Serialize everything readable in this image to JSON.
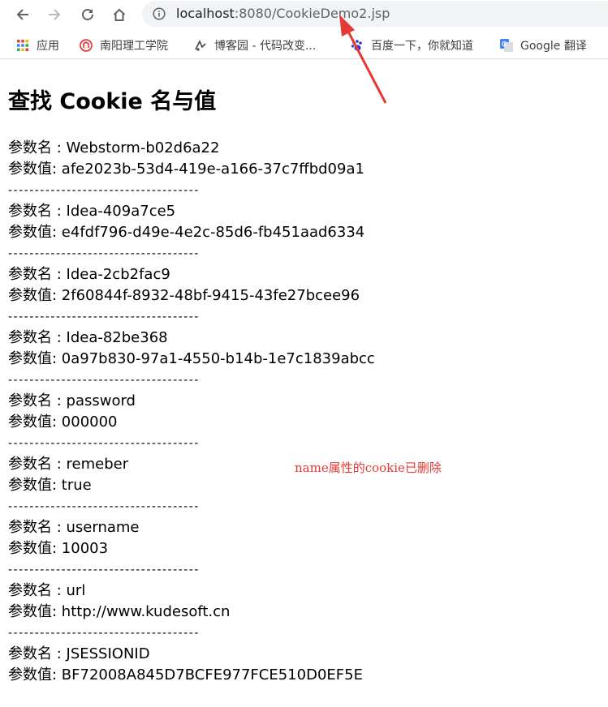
{
  "browser": {
    "url_host": "localhost",
    "url_rest": ":8080/CookieDemo2.jsp",
    "bookmarks": [
      {
        "label": "应用",
        "icon": "apps-grid-icon"
      },
      {
        "label": "南阳理工学院",
        "icon": "school-logo-icon"
      },
      {
        "label": "博客园 - 代码改变...",
        "icon": "cnblogs-icon"
      },
      {
        "label": "百度一下，你就知道",
        "icon": "baidu-paw-icon"
      },
      {
        "label": "Google 翻译",
        "icon": "google-translate-icon"
      }
    ]
  },
  "page": {
    "title": "查找 Cookie 名与值",
    "name_prefix": "参数名 : ",
    "value_prefix": "参数值: ",
    "separator": "------------------------------------",
    "cookies": [
      {
        "name": "Webstorm-b02d6a22",
        "value": "afe2023b-53d4-419e-a166-37c7ffbd09a1"
      },
      {
        "name": "Idea-409a7ce5",
        "value": "e4fdf796-d49e-4e2c-85d6-fb451aad6334"
      },
      {
        "name": "Idea-2cb2fac9",
        "value": "2f60844f-8932-48bf-9415-43fe27bcee96"
      },
      {
        "name": "Idea-82be368",
        "value": "0a97b830-97a1-4550-b14b-1e7c1839abcc"
      },
      {
        "name": "password",
        "value": "000000"
      },
      {
        "name": "remeber",
        "value": "true"
      },
      {
        "name": "username",
        "value": "10003"
      },
      {
        "name": "url",
        "value": "http://www.kudesoft.cn"
      },
      {
        "name": "JSESSIONID",
        "value": "BF72008A845D7BCFE977FCE510D0EF5E"
      }
    ]
  },
  "annotation": {
    "text": "name属性的cookie已删除",
    "color": "#e53935"
  }
}
